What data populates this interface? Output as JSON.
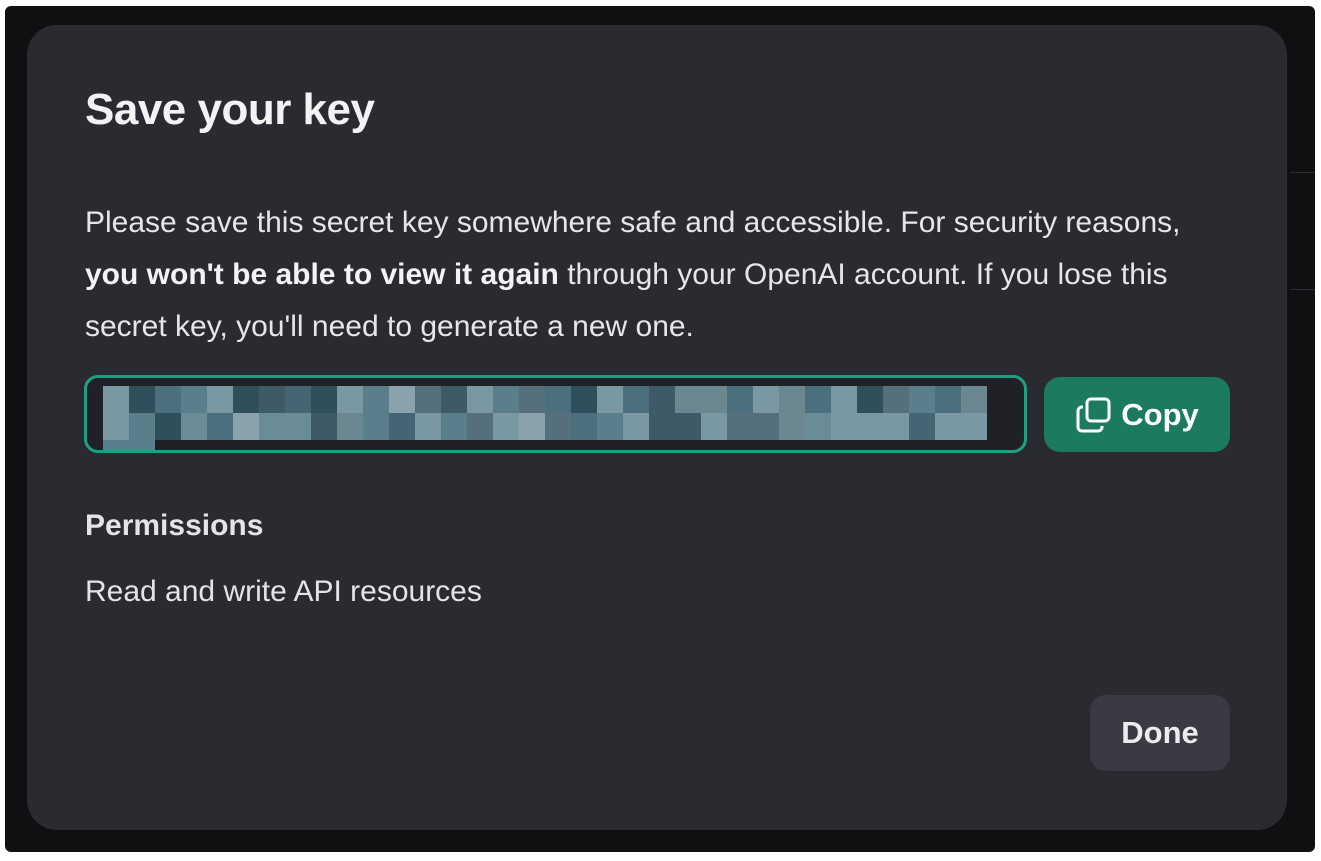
{
  "dialog": {
    "title": "Save your key",
    "description": {
      "before": "Please save this secret key somewhere safe and accessible. For security reasons, ",
      "emphasis": "you won't be able to view it again",
      "after": " through your OpenAI account. If you lose this secret key, you'll need to generate a new one."
    },
    "key_field": {
      "value_redacted": true
    },
    "copy_button": {
      "label": "Copy",
      "icon": "copy-icon"
    },
    "permissions": {
      "heading": "Permissions",
      "value": "Read and write API resources"
    },
    "done_button": {
      "label": "Done"
    }
  },
  "colors": {
    "backdrop": "#0f1012",
    "modal": "#2a2b31",
    "accent": "#1c7b5f",
    "field_border": "#1f9f7f",
    "secondary_button": "#3a3b42"
  }
}
